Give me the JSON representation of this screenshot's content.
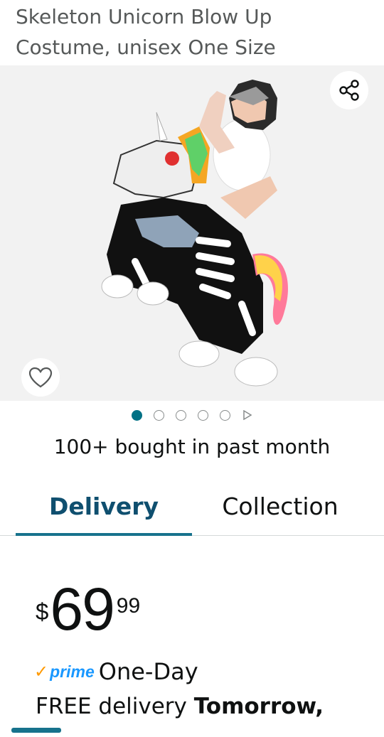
{
  "product": {
    "title": "Skeleton Unicorn Blow Up Costume, unisex One Size",
    "image_alt": "Skeleton Unicorn inflatable costume"
  },
  "gallery": {
    "image_count": 5,
    "active_index": 0
  },
  "social_proof": {
    "bought": "100+ bought in past month"
  },
  "tabs": [
    {
      "label": "Delivery",
      "active": true
    },
    {
      "label": "Collection",
      "active": false
    }
  ],
  "price": {
    "currency": "$",
    "whole": "69",
    "fraction": "99"
  },
  "prime": {
    "logo": "prime",
    "speed": "One-Day"
  },
  "delivery": {
    "prefix": "FREE delivery",
    "day": "Tomorrow,"
  },
  "icons": {
    "share": "share-icon",
    "wishlist": "heart-icon"
  },
  "colors": {
    "accent": "#007185",
    "tab_active": "#0f4f6f",
    "prime_blue": "#1a98ff",
    "prime_check": "#ff9900"
  }
}
